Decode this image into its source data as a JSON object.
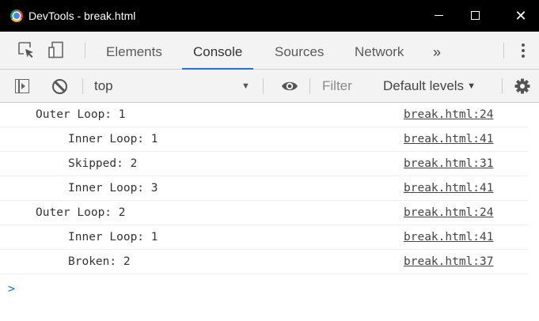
{
  "window": {
    "title": "DevTools - break.html",
    "controls": {
      "minimize": "",
      "maximize": "",
      "close": "✕"
    }
  },
  "tabs": {
    "items": [
      {
        "label": "Elements",
        "active": false
      },
      {
        "label": "Console",
        "active": true
      },
      {
        "label": "Sources",
        "active": false
      },
      {
        "label": "Network",
        "active": false
      }
    ],
    "more_label": "»"
  },
  "console_toolbar": {
    "context": "top",
    "filter_placeholder": "Filter",
    "levels_label": "Default levels",
    "dropdown_arrow": "▼"
  },
  "messages": [
    {
      "text": "Outer Loop: 1",
      "indent": 0,
      "source": "break.html:24"
    },
    {
      "text": "Inner Loop: 1",
      "indent": 1,
      "source": "break.html:41"
    },
    {
      "text": "Skipped: 2",
      "indent": 1,
      "source": "break.html:31"
    },
    {
      "text": "Inner Loop: 3",
      "indent": 1,
      "source": "break.html:41"
    },
    {
      "text": "Outer Loop: 2",
      "indent": 0,
      "source": "break.html:24"
    },
    {
      "text": "Inner Loop: 1",
      "indent": 1,
      "source": "break.html:41"
    },
    {
      "text": "Broken: 2",
      "indent": 1,
      "source": "break.html:37"
    }
  ],
  "prompt_symbol": ">",
  "colors": {
    "accent": "#1a73e8",
    "toolbar_bg": "#f3f3f3",
    "titlebar_bg": "#000000"
  }
}
